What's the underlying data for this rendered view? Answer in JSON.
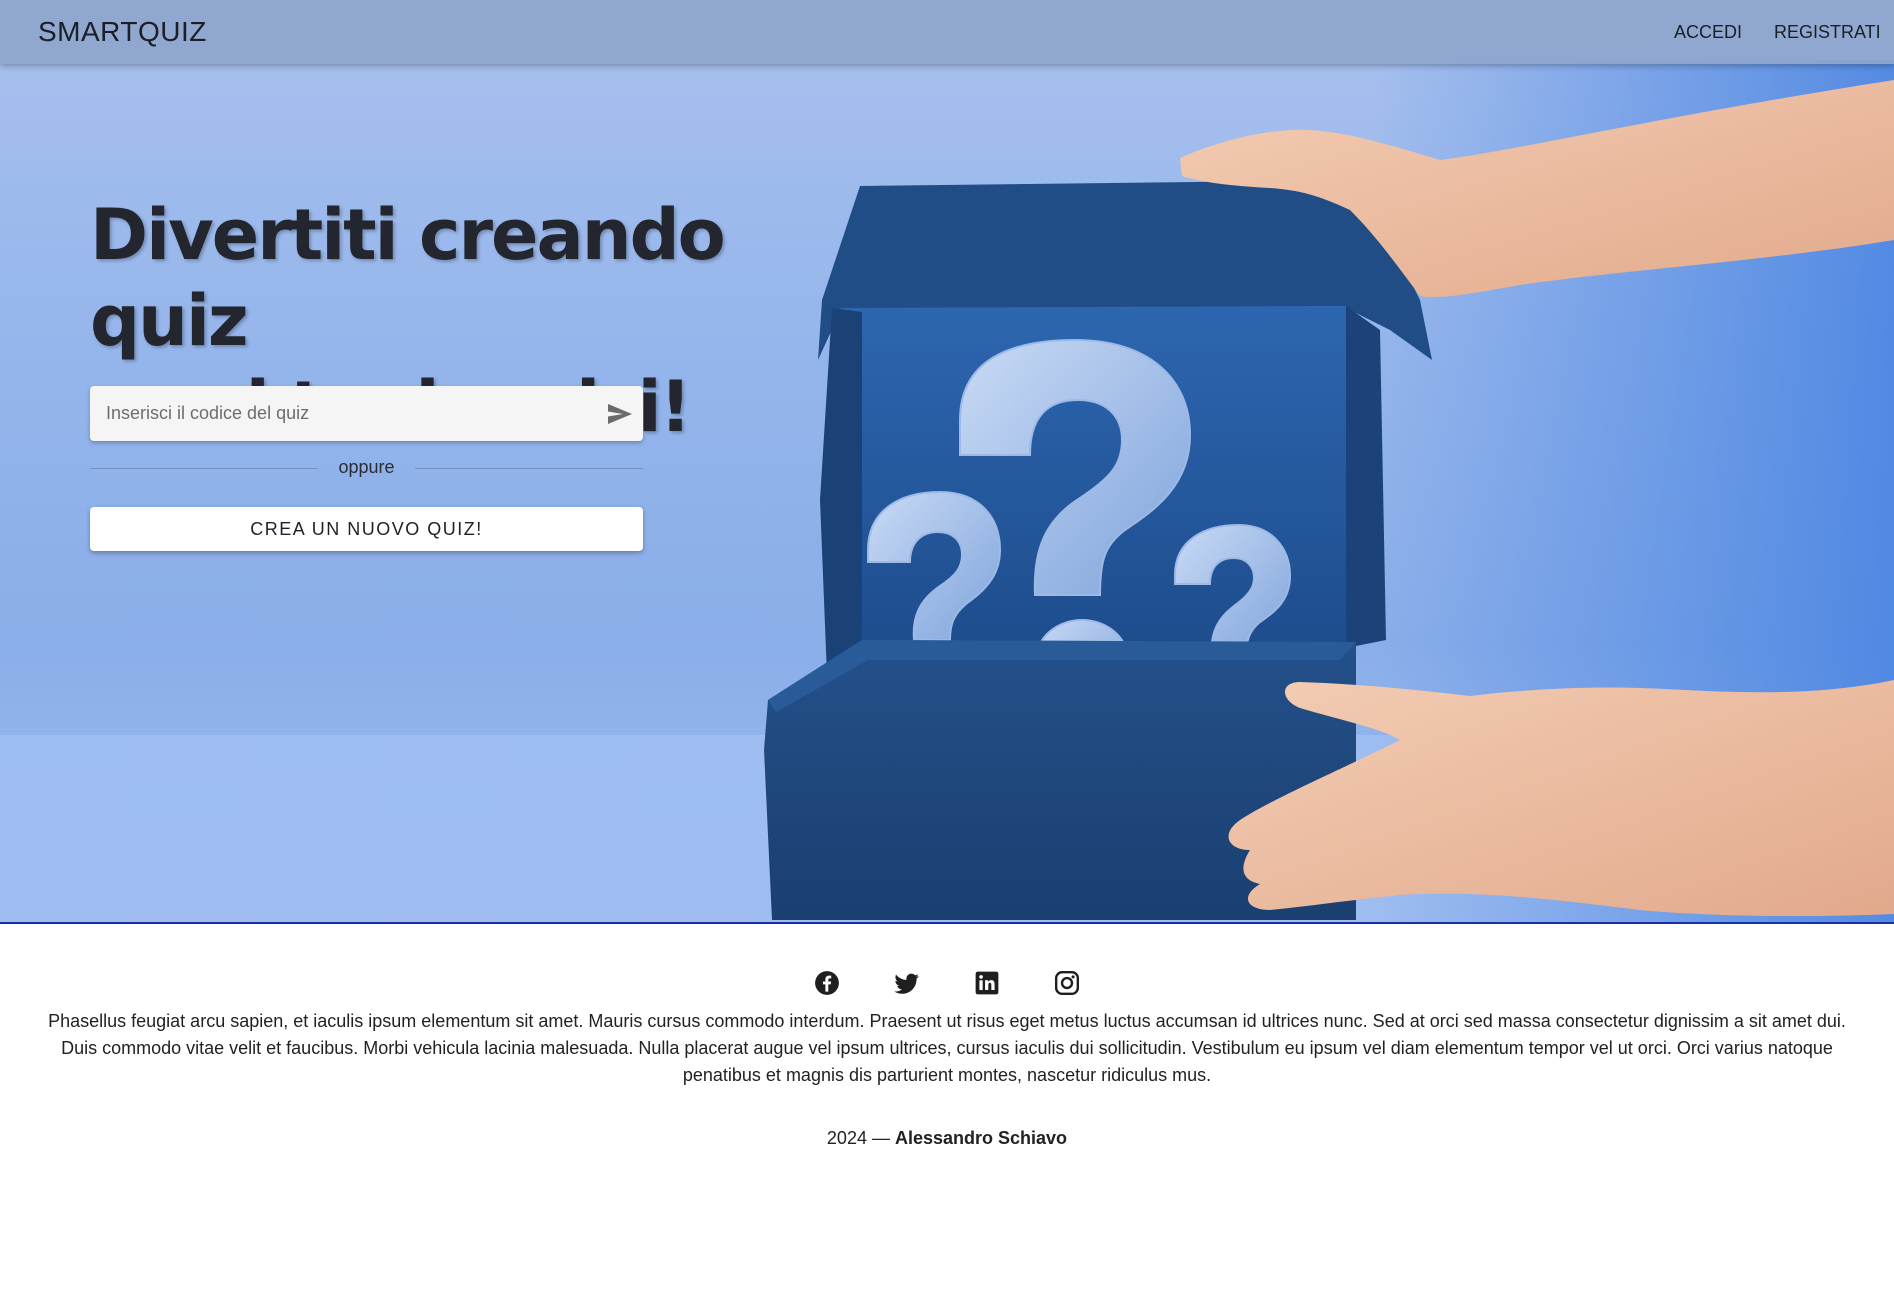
{
  "navbar": {
    "brand": "SMARTQUIZ",
    "links": [
      "ACCEDI",
      "REGISTRATI"
    ]
  },
  "hero": {
    "headline_line1": "Divertiti creando quiz",
    "headline_line2": "con i tuoi amici!",
    "quiz_code_placeholder": "Inserisci il codice del quiz",
    "divider_label": "oppure",
    "create_button": "CREA UN NUOVO QUIZ!",
    "send_icon": "send-icon"
  },
  "footer": {
    "social_icons": [
      "facebook-icon",
      "twitter-icon",
      "linkedin-icon",
      "instagram-icon"
    ],
    "description": "Phasellus feugiat arcu sapien, et iaculis ipsum elementum sit amet. Mauris cursus commodo interdum. Praesent ut risus eget metus luctus accumsan id ultrices nunc. Sed at orci sed massa consectetur dignissim a sit amet dui. Duis commodo vitae velit et faucibus. Morbi vehicula lacinia malesuada. Nulla placerat augue vel ipsum ultrices, cursus iaculis dui sollicitudin. Vestibulum eu ipsum vel diam elementum tempor vel ut orci. Orci varius natoque penatibus et magnis dis parturient montes, nascetur ridiculus mus.",
    "year": "2024 —",
    "author": "Alessandro Schiavo"
  },
  "colors": {
    "hero_background": "#96b6ec",
    "box_blue": "#1f4b82",
    "navbar_background": "#8ea6cd",
    "hero_bottom_border": "#1a2ea8"
  }
}
